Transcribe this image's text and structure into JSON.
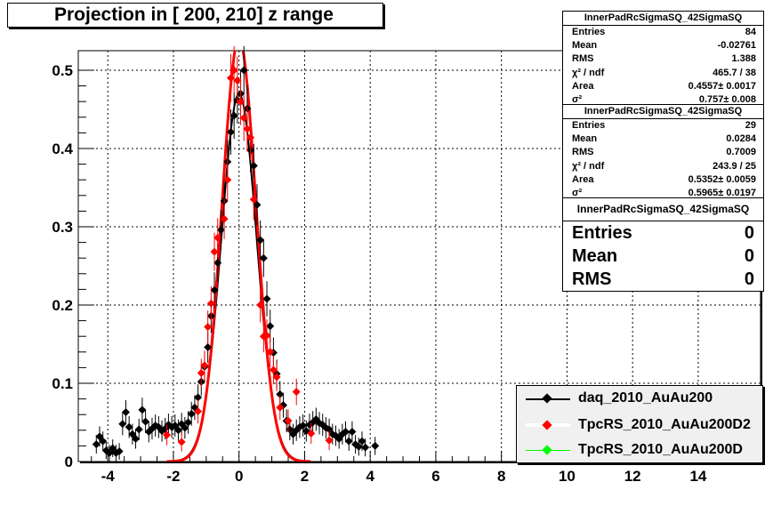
{
  "plot_title": "Projection in [ 200, 210] z range",
  "stats": [
    {
      "title": "InnerPadRcSigmaSQ_42SigmaSQ",
      "rows": [
        {
          "label": "Entries",
          "value": "84"
        },
        {
          "label": "Mean",
          "value": "-0.02761"
        },
        {
          "label": "RMS",
          "value": "1.388"
        },
        {
          "label": "χ² / ndf",
          "value": "465.7 / 38"
        },
        {
          "label": "Area",
          "value": "0.4557± 0.0017"
        },
        {
          "label": "σ²",
          "value": "0.757± 0.008"
        }
      ]
    },
    {
      "title": "InnerPadRcSigmaSQ_42SigmaSQ",
      "rows": [
        {
          "label": "Entries",
          "value": "29"
        },
        {
          "label": "Mean",
          "value": "0.0284"
        },
        {
          "label": "RMS",
          "value": "0.7009"
        },
        {
          "label": "χ² / ndf",
          "value": "243.9 / 25"
        },
        {
          "label": "Area",
          "value": "0.5352± 0.0059"
        },
        {
          "label": "σ²",
          "value": "0.5965± 0.0197"
        }
      ]
    },
    {
      "title": "InnerPadRcSigmaSQ_42SigmaSQ",
      "rows": [
        {
          "label": "Entries",
          "value": "0"
        },
        {
          "label": "Mean",
          "value": "0"
        },
        {
          "label": "RMS",
          "value": "0"
        }
      ]
    }
  ],
  "colors": {
    "daq": "#000000",
    "tpcrs_d2": "#ff0000",
    "tpcrs_d": "#00ff00",
    "grid": "#000000"
  },
  "chart_data": {
    "type": "scatter",
    "xlim": [
      -4.9,
      15.9
    ],
    "ylim": [
      0,
      0.525
    ],
    "xticks": [
      -4,
      -2,
      0,
      2,
      4,
      6,
      8,
      10,
      12,
      14
    ],
    "yticks": [
      0,
      0.1,
      0.2,
      0.3,
      0.4,
      0.5
    ],
    "grid": true,
    "legend_position": "bottom-right",
    "series": [
      {
        "name": "daq_2010_AuAu200",
        "color": "#000000",
        "points": [
          [
            -4.35,
            0.022
          ],
          [
            -4.25,
            0.032
          ],
          [
            -4.15,
            0.026
          ],
          [
            -4.05,
            0.014
          ],
          [
            -3.95,
            0.011
          ],
          [
            -3.85,
            0.017
          ],
          [
            -3.75,
            0.011
          ],
          [
            -3.65,
            0.013
          ],
          [
            -3.55,
            0.048
          ],
          [
            -3.45,
            0.063
          ],
          [
            -3.35,
            0.044
          ],
          [
            -3.25,
            0.035
          ],
          [
            -3.15,
            0.029
          ],
          [
            -3.05,
            0.041
          ],
          [
            -2.95,
            0.066
          ],
          [
            -2.85,
            0.051
          ],
          [
            -2.75,
            0.038
          ],
          [
            -2.65,
            0.042
          ],
          [
            -2.55,
            0.046
          ],
          [
            -2.45,
            0.044
          ],
          [
            -2.35,
            0.039
          ],
          [
            -2.25,
            0.042
          ],
          [
            -2.15,
            0.047
          ],
          [
            -2.05,
            0.044
          ],
          [
            -1.95,
            0.046
          ],
          [
            -1.85,
            0.04
          ],
          [
            -1.75,
            0.048
          ],
          [
            -1.65,
            0.043
          ],
          [
            -1.55,
            0.05
          ],
          [
            -1.45,
            0.061
          ],
          [
            -1.35,
            0.069
          ],
          [
            -1.25,
            0.082
          ],
          [
            -1.15,
            0.102
          ],
          [
            -1.05,
            0.121
          ],
          [
            -0.95,
            0.146
          ],
          [
            -0.85,
            0.186
          ],
          [
            -0.75,
            0.219
          ],
          [
            -0.65,
            0.254
          ],
          [
            -0.55,
            0.296
          ],
          [
            -0.45,
            0.333
          ],
          [
            -0.35,
            0.383
          ],
          [
            -0.25,
            0.421
          ],
          [
            -0.15,
            0.442
          ],
          [
            -0.05,
            0.462
          ],
          [
            0.05,
            0.47
          ],
          [
            0.15,
            0.5
          ],
          [
            0.25,
            0.451
          ],
          [
            0.35,
            0.398
          ],
          [
            0.45,
            0.378
          ],
          [
            0.55,
            0.328
          ],
          [
            0.65,
            0.283
          ],
          [
            0.75,
            0.26
          ],
          [
            0.85,
            0.208
          ],
          [
            0.95,
            0.173
          ],
          [
            1.05,
            0.139
          ],
          [
            1.15,
            0.112
          ],
          [
            1.25,
            0.086
          ],
          [
            1.35,
            0.072
          ],
          [
            1.45,
            0.052
          ],
          [
            1.55,
            0.041
          ],
          [
            1.65,
            0.035
          ],
          [
            1.75,
            0.04
          ],
          [
            1.85,
            0.044
          ],
          [
            1.95,
            0.046
          ],
          [
            2.05,
            0.039
          ],
          [
            2.15,
            0.047
          ],
          [
            2.25,
            0.05
          ],
          [
            2.35,
            0.054
          ],
          [
            2.45,
            0.049
          ],
          [
            2.55,
            0.047
          ],
          [
            2.65,
            0.043
          ],
          [
            2.75,
            0.041
          ],
          [
            2.85,
            0.035
          ],
          [
            2.95,
            0.033
          ],
          [
            3.05,
            0.029
          ],
          [
            3.15,
            0.035
          ],
          [
            3.25,
            0.038
          ],
          [
            3.35,
            0.026
          ],
          [
            3.45,
            0.038
          ],
          [
            3.55,
            0.022
          ],
          [
            3.65,
            0.019
          ],
          [
            3.75,
            0.026
          ],
          [
            3.85,
            0.018
          ],
          [
            4.15,
            0.02
          ]
        ]
      },
      {
        "name": "TpcRS_2010_AuAu200D2",
        "color": "#ff0000",
        "points": [
          [
            -2.2,
            0.034
          ],
          [
            -1.75,
            0.025
          ],
          [
            -1.25,
            0.064
          ],
          [
            -1.15,
            0.113
          ],
          [
            -1.05,
            0.123
          ],
          [
            -0.95,
            0.172
          ],
          [
            -0.85,
            0.202
          ],
          [
            -0.75,
            0.268
          ],
          [
            -0.65,
            0.286
          ],
          [
            -0.45,
            0.31
          ],
          [
            -0.35,
            0.36
          ],
          [
            -0.25,
            0.49
          ],
          [
            -0.15,
            0.5
          ],
          [
            -0.05,
            0.487
          ],
          [
            0.05,
            0.46
          ],
          [
            0.15,
            0.439
          ],
          [
            0.25,
            0.425
          ],
          [
            0.35,
            0.414
          ],
          [
            0.45,
            0.335
          ],
          [
            0.65,
            0.2
          ],
          [
            0.75,
            0.16
          ],
          [
            0.85,
            0.161
          ],
          [
            0.95,
            0.14
          ],
          [
            1.05,
            0.117
          ],
          [
            1.15,
            0.108
          ],
          [
            1.25,
            0.069
          ],
          [
            1.5,
            0.052
          ],
          [
            1.75,
            0.089
          ],
          [
            2.2,
            0.036
          ],
          [
            2.75,
            0.027
          ]
        ]
      },
      {
        "name": "TpcRS_2010_AuAu200D",
        "color": "#00ff00",
        "points": []
      }
    ],
    "fits": [
      {
        "series": "daq_2010_AuAu200",
        "type": "gaussian",
        "amplitude": 0.47,
        "mean": 0.0,
        "sigma": 0.54,
        "color": "#000000"
      },
      {
        "series": "TpcRS_2010_AuAu200D2",
        "type": "gaussian",
        "amplitude": 0.54,
        "mean": 0.0,
        "sigma": 0.52,
        "color": "#ff0000"
      }
    ]
  }
}
